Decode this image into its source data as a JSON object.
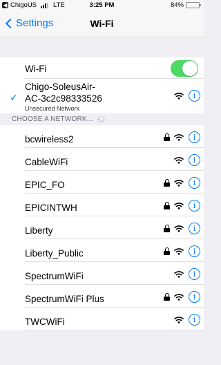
{
  "status_bar": {
    "back_app": "ChigoUS",
    "carrier": "LTE",
    "time": "3:25 PM",
    "battery": "84%",
    "battery_level": 0.84
  },
  "nav": {
    "back_label": "Settings",
    "title": "Wi-Fi"
  },
  "wifi_toggle": {
    "label": "Wi-Fi",
    "on": true,
    "color": "#4cd964"
  },
  "connected": {
    "name_line1": "Chigo-SoleusAir-",
    "name_line2": "AC-3c2c98333526",
    "subtitle": "Unsecured Network",
    "info_glyph": "i"
  },
  "section_header": "CHOOSE A NETWORK...",
  "networks": [
    {
      "name": "bcwireless2",
      "locked": true,
      "info_glyph": "i"
    },
    {
      "name": "CableWiFi",
      "locked": false,
      "info_glyph": "i"
    },
    {
      "name": "EPIC_FO",
      "locked": true,
      "info_glyph": "i"
    },
    {
      "name": "EPICINTWH",
      "locked": true,
      "info_glyph": "i"
    },
    {
      "name": "Liberty",
      "locked": true,
      "info_glyph": "i"
    },
    {
      "name": "Liberty_Public",
      "locked": true,
      "info_glyph": "i"
    },
    {
      "name": "SpectrumWiFi",
      "locked": false,
      "info_glyph": "i"
    },
    {
      "name": "SpectrumWiFi Plus",
      "locked": true,
      "info_glyph": "i"
    },
    {
      "name": "TWCWiFi",
      "locked": false,
      "info_glyph": "i"
    }
  ],
  "colors": {
    "accent": "#007aff",
    "background": "#efeff4"
  }
}
